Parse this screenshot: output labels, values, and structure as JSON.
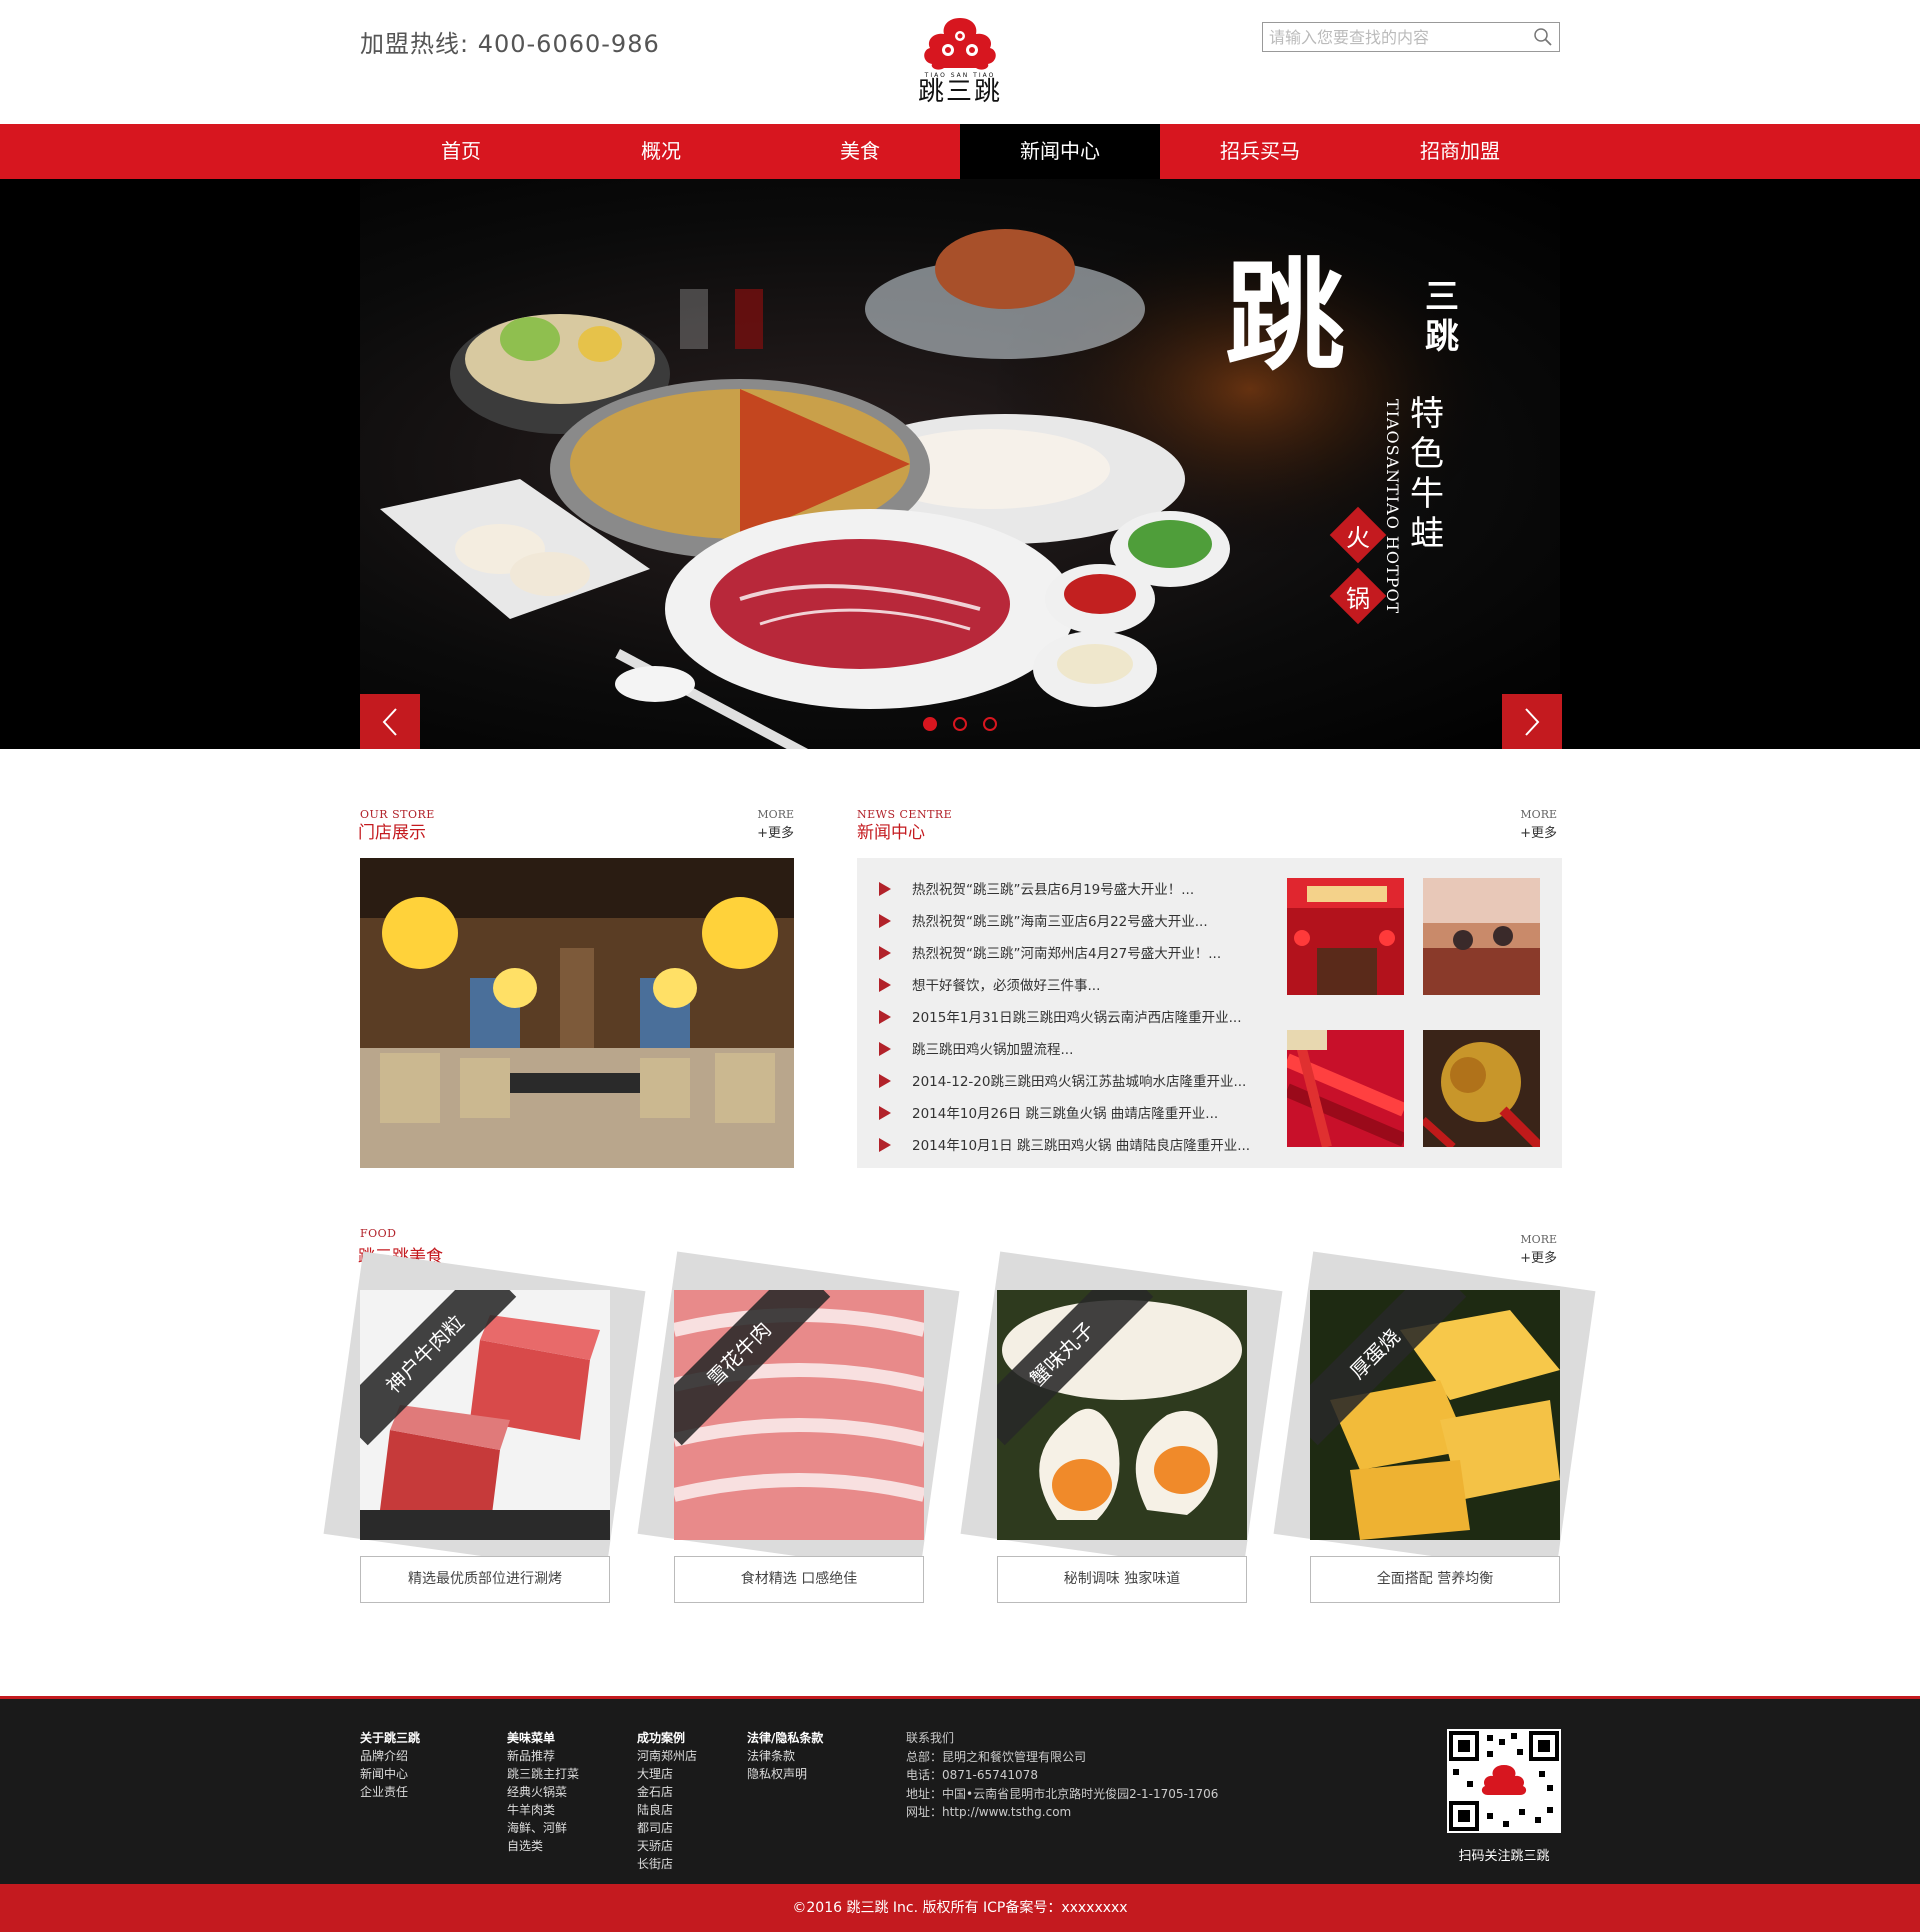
{
  "header": {
    "hotline": "加盟热线: 400-6060-986",
    "logo_pinyin": "TIAO SAN TIAO",
    "logo_text": "跳三跳",
    "search_placeholder": "请输入您要查找的内容"
  },
  "nav": {
    "items": [
      {
        "label": "首页"
      },
      {
        "label": "概况"
      },
      {
        "label": "美食"
      },
      {
        "label": "新闻中心",
        "active": true
      },
      {
        "label": "招兵买马"
      },
      {
        "label": "招商加盟"
      }
    ]
  },
  "banner": {
    "brand_big": "跳",
    "brand_small": "三跳",
    "slogan": "特色牛蛙",
    "slogan_en": "TIAOSANTIAO HOTPOT",
    "tag1": "火",
    "tag2": "锅",
    "slides": 3,
    "active_slide": 1
  },
  "store": {
    "title_en": "OUR STORE",
    "title_cn": "门店展示",
    "more_en": "MORE",
    "more_cn": "+更多"
  },
  "news": {
    "title_en": "NEWS CENTRE",
    "title_cn": "新闻中心",
    "more_en": "MORE",
    "more_cn": "+更多",
    "items": [
      "热烈祝贺“跳三跳”云县店6月19号盛大开业！...",
      "热烈祝贺“跳三跳”海南三亚店6月22号盛大开业...",
      "热烈祝贺“跳三跳”河南郑州店4月27号盛大开业！...",
      "想干好餐饮，必须做好三件事...",
      "2015年1月31日跳三跳田鸡火锅云南泸西店隆重开业...",
      "跳三跳田鸡火锅加盟流程...",
      "2014-12-20跳三跳田鸡火锅江苏盐城响水店隆重开业...",
      "2014年10月26日 跳三跳鱼火锅 曲靖店隆重开业...",
      "2014年10月1日 跳三跳田鸡火锅 曲靖陆良店隆重开业..."
    ]
  },
  "food": {
    "title_en": "FOOD",
    "title_cn": "跳三跳美食",
    "more_en": "MORE",
    "more_cn": "+更多",
    "items": [
      {
        "name": "神户牛肉粒",
        "caption": "精选最优质部位进行涮烤"
      },
      {
        "name": "雪花牛肉",
        "caption": "食材精选 口感绝佳"
      },
      {
        "name": "蟹味丸子",
        "caption": "秘制调味 独家味道"
      },
      {
        "name": "厚蛋烧",
        "caption": "全面搭配 营养均衡"
      }
    ]
  },
  "footer": {
    "columns": [
      {
        "heading": "关于跳三跳",
        "links": [
          "品牌介绍",
          "新闻中心",
          "企业责任"
        ]
      },
      {
        "heading": "美味菜单",
        "links": [
          "新品推荐",
          "跳三跳主打菜",
          "经典火锅菜",
          "牛羊肉类",
          "海鲜、河鲜",
          "自选类"
        ]
      },
      {
        "heading": "成功案例",
        "links": [
          "河南郑州店",
          "大理店",
          "金石店",
          "陆良店",
          "都司店",
          "天骄店",
          "长街店"
        ]
      },
      {
        "heading": "法律/隐私条款",
        "links": [
          "法律条款",
          "隐私权声明"
        ]
      }
    ],
    "contact": {
      "heading": "联系我们",
      "lines": [
        "总部：昆明之和餐饮管理有限公司",
        "电话：0871-65741078",
        "地址：中国•云南省昆明市北京路时光俊园2-1-1705-1706",
        "网址：http://www.tsthg.com"
      ]
    },
    "qr_caption": "扫码关注跳三跳",
    "copyright": "©2016 跳三跳 Inc. 版权所有    ICP备案号：xxxxxxxx"
  },
  "colors": {
    "brand_red": "#d7161f",
    "nav_active": "#000000",
    "footer_bg": "#1a1a1a"
  }
}
